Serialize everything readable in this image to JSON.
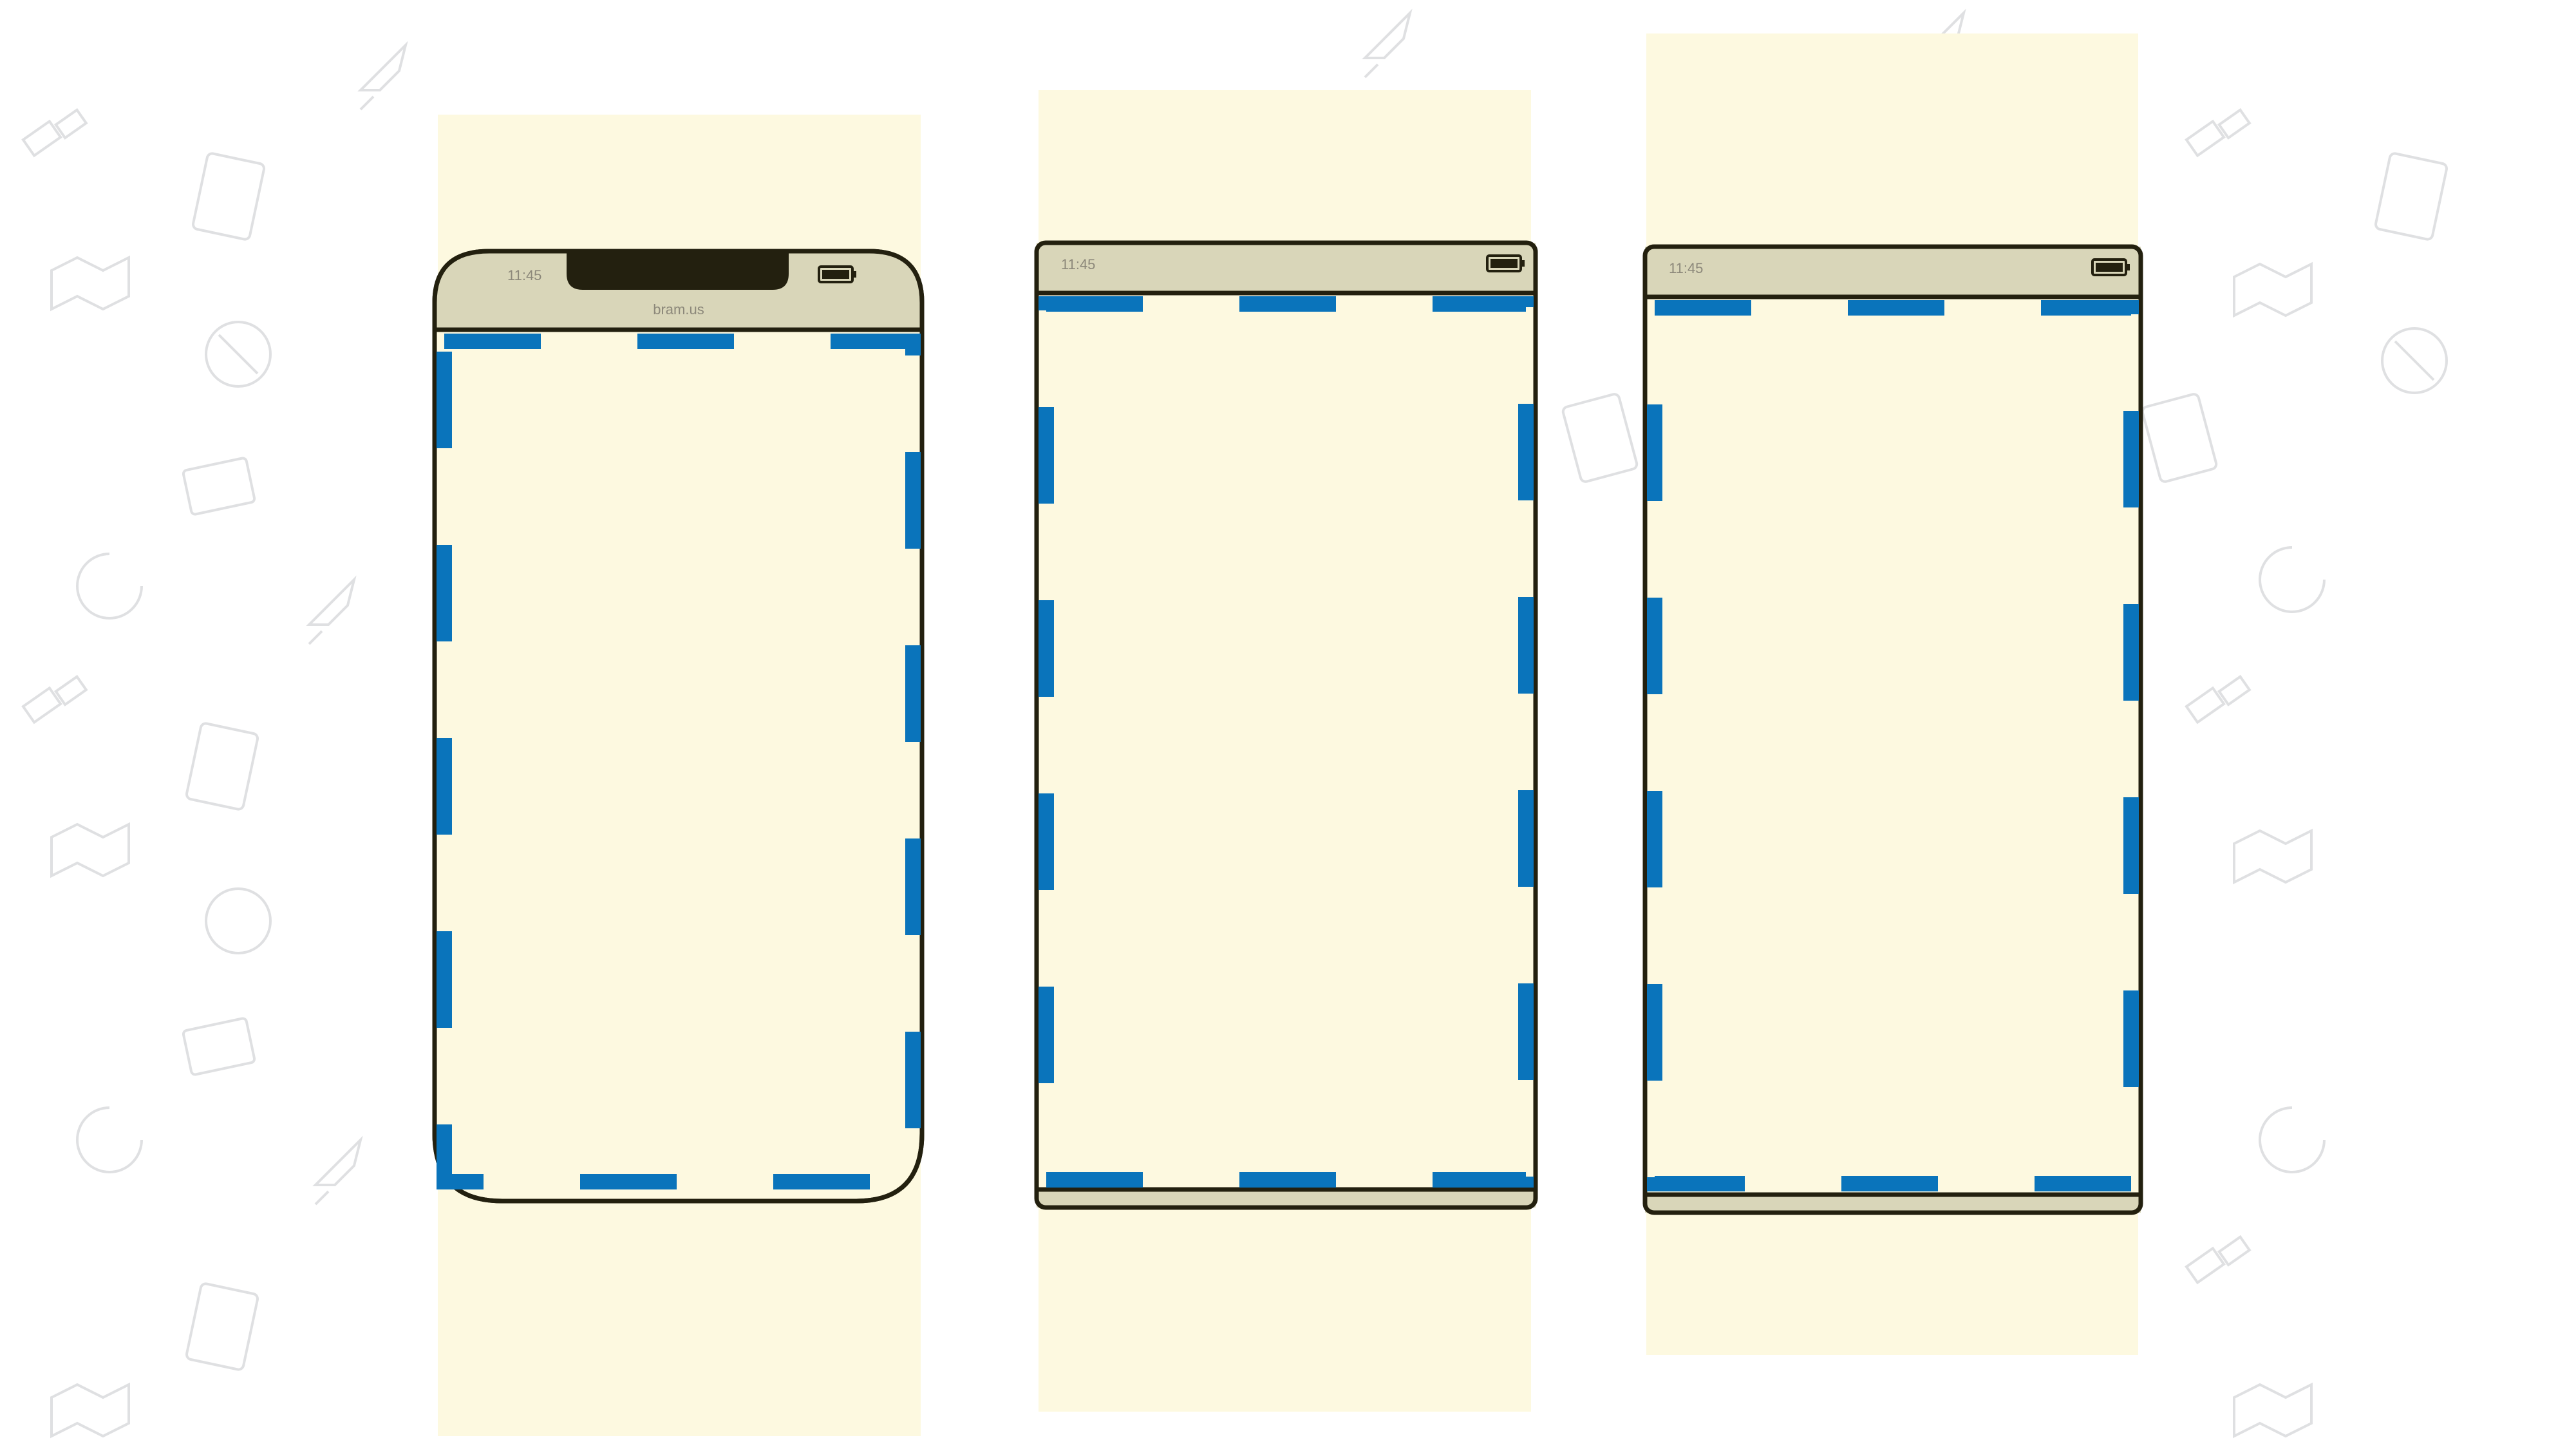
{
  "colors": {
    "page_background": "#ffffff",
    "viewport_fill": "#fdf9e0",
    "device_screen": "#fdf9e0",
    "device_chrome": "#d9d6b9",
    "device_outline": "#23200f",
    "dashed_border": "#0a74bb",
    "status_text": "#8c887a",
    "background_icons": "#c9cbcf"
  },
  "background_icons": [
    "rocket-icon",
    "satellite-icon",
    "html-file-icon",
    "map-pin-icon",
    "browser-icon",
    "laptop-icon",
    "refresh-icon",
    "css-file-icon"
  ],
  "devices": [
    {
      "kind": "phone-with-notch",
      "status_time": "11:45",
      "url": "bram.us",
      "battery_icon": "battery-icon",
      "notch_icon": "notch"
    },
    {
      "kind": "phone-flat",
      "status_time": "11:45",
      "battery_icon": "battery-icon"
    },
    {
      "kind": "phone-flat",
      "status_time": "11:45",
      "battery_icon": "battery-icon"
    }
  ]
}
